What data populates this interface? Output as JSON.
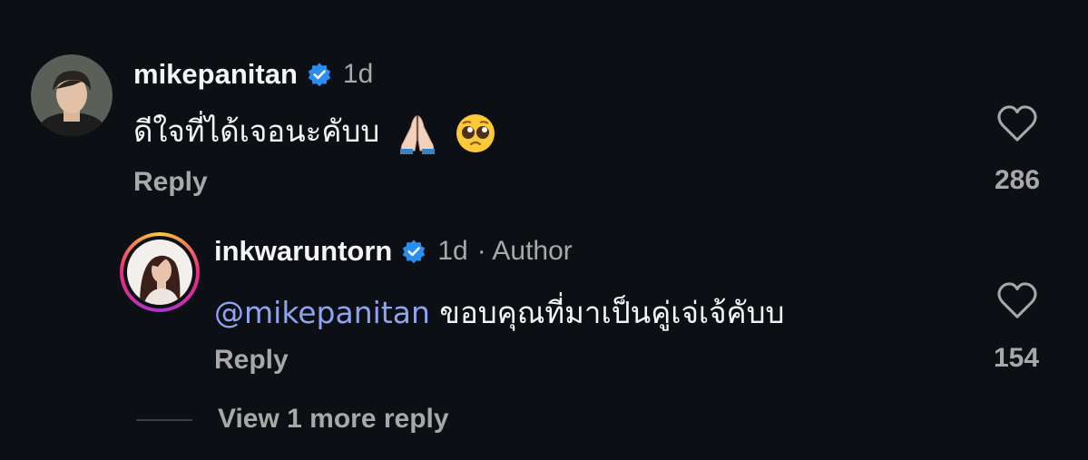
{
  "comments": [
    {
      "username": "mikepanitan",
      "time": "1d",
      "text": "ดีใจที่ได้เจอนะคับบ",
      "emoji_names": [
        "folded-hands-emoji",
        "pleading-face-emoji"
      ],
      "reply_label": "Reply",
      "like_count": "286"
    },
    {
      "username": "inkwaruntorn",
      "time": "1d",
      "author_tag": "· Author",
      "mention": "@mikepanitan",
      "text": "ขอบคุณที่มาเป็นคู่เจ่เจ้คับบ",
      "reply_label": "Reply",
      "like_count": "154"
    }
  ],
  "view_more_label": "View 1 more reply",
  "colors": {
    "background": "#0c0f14",
    "verified_blue": "#2a8ef0",
    "mention": "#8fa3f0",
    "muted": "#a8a8a8",
    "story_ring_start": "#f9ce34",
    "story_ring_mid": "#ee2a7b",
    "story_ring_end": "#a438d0"
  },
  "icons": [
    "verified-badge-icon",
    "heart-icon"
  ]
}
